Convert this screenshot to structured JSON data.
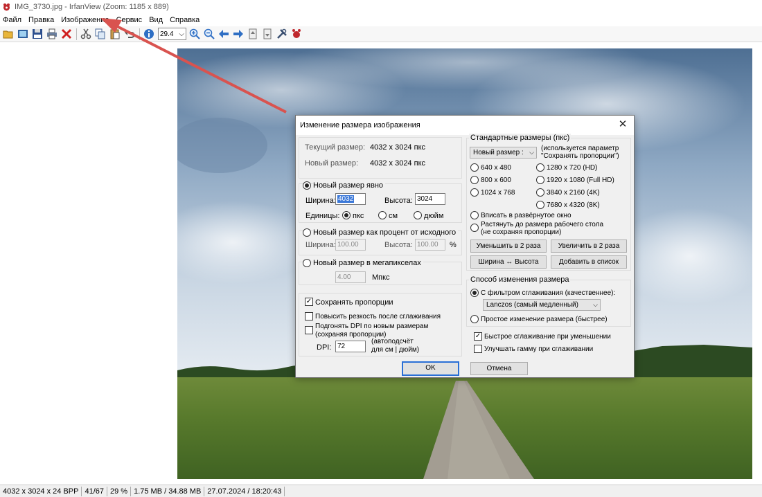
{
  "window": {
    "title": "IMG_3730.jpg - IrfanView (Zoom: 1185 x 889)"
  },
  "menu": [
    "Файл",
    "Правка",
    "Изображение",
    "Сервис",
    "Вид",
    "Справка"
  ],
  "toolbar": {
    "zoom_value": "29.4",
    "icons": [
      "open-icon",
      "slideshow-icon",
      "save-icon",
      "print-icon",
      "delete-icon",
      "cut-icon",
      "copy-icon",
      "paste-icon",
      "undo-icon",
      "info-icon",
      "zoom-in-icon",
      "zoom-out-icon",
      "previous-icon",
      "next-icon",
      "first-page-icon",
      "last-page-icon",
      "settings-icon",
      "exit-icon"
    ]
  },
  "status": [
    "4032 x 3024 x 24 BPP",
    "41/67",
    "29 %",
    "1.75 MB / 34.88 MB",
    "27.07.2024 / 18:20:43"
  ],
  "dialog": {
    "title": "Изменение размера изображения",
    "current_size_label": "Текущий размер:",
    "current_size_value": "4032  x  3024  пкс",
    "new_size_label": "Новый размер:",
    "new_size_value": "4032  x  3024  пкс",
    "explicit": {
      "label": "Новый размер явно",
      "width_label": "Ширина:",
      "width_value": "4032",
      "height_label": "Высота:",
      "height_value": "3024",
      "units_label": "Единицы:",
      "unit_px": "пкс",
      "unit_cm": "см",
      "unit_inch": "дюйм"
    },
    "percent": {
      "label": "Новый размер как процент от исходного",
      "width_label": "Ширина:",
      "width_value": "100.00",
      "height_label": "Высота:",
      "height_value": "100.00",
      "pct": "%"
    },
    "megapixels": {
      "label": "Новый размер в мегапикселах",
      "value": "4.00",
      "unit": "Мпкс"
    },
    "options": {
      "keep_ratio": "Сохранять пропорции",
      "sharpen": "Повысить резкость после сглаживания",
      "dpi_fit_1": "Подгонять DPI по новым размерам",
      "dpi_fit_2": "(сохраняя пропорции)",
      "dpi_label": "DPI:",
      "dpi_value": "72",
      "dpi_note_1": "(автоподсчёт",
      "dpi_note_2": "для см | дюйм)"
    },
    "standard": {
      "title": "Стандартные размеры (пкс)",
      "combo": "Новый размер  :",
      "note_1": "(используется параметр",
      "note_2": "\"Сохранять пропорции\")",
      "sizes": [
        "640 x 480",
        "1280 x 720  (HD)",
        "800 x 600",
        "1920 x 1080 (Full HD)",
        "1024 x 768",
        "3840 x 2160 (4K)",
        "7680 x 4320 (8K)"
      ],
      "fit_window": "Вписать в развёрнутое окно",
      "stretch_1": "Растянуть до размера рабочего стола",
      "stretch_2": "(не сохраняя пропорции)",
      "half": "Уменьшить в 2 раза",
      "double": "Увеличить в 2 раза",
      "swap": "Ширина ↔ Высота",
      "add_list": "Добавить в список"
    },
    "method": {
      "title": "Способ изменения размера",
      "filter": "С фильтром сглаживания (качественнее):",
      "filter_value": "Lanczos (самый медленный)",
      "simple": "Простое изменение размера (быстрее)",
      "fast_smooth": "Быстрое сглаживание при уменьшении",
      "gamma": "Улучшать гамму при сглаживании"
    },
    "ok": "OK",
    "cancel": "Отмена"
  }
}
